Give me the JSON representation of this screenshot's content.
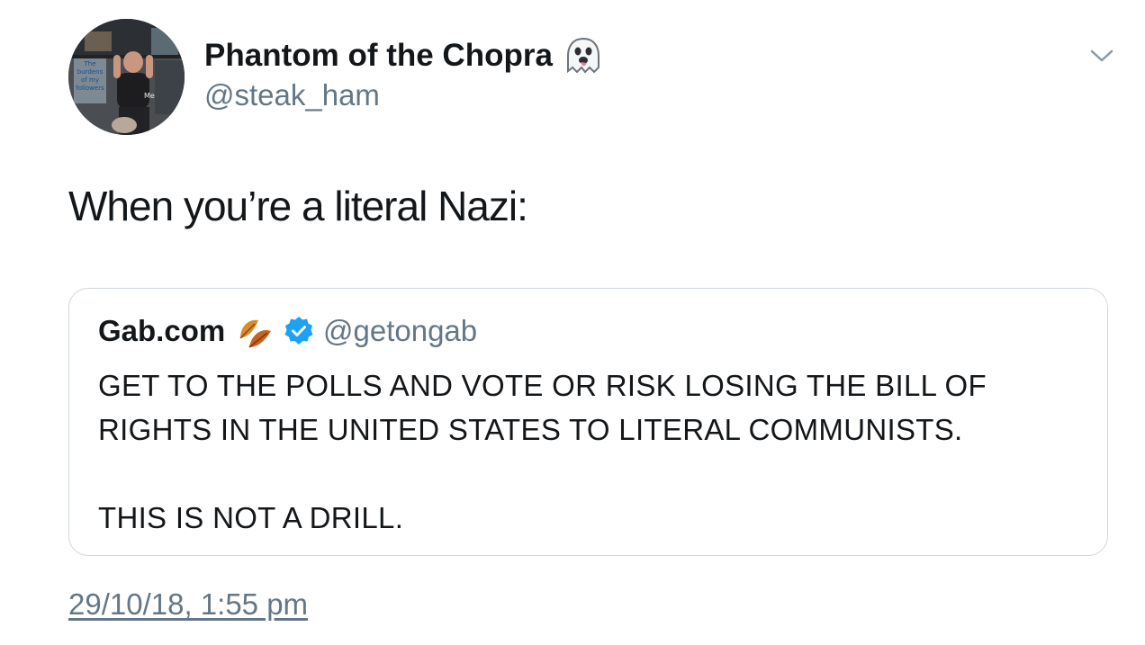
{
  "tweet": {
    "author": {
      "display_name": "Phantom of the Chopra",
      "name_emoji_icon": "ghost-emoji-icon",
      "handle": "@steak_ham",
      "avatar_caption_left": "The burdens of my followers",
      "avatar_caption_right": "Me"
    },
    "menu_icon": "chevron-down-icon",
    "text": "When you’re a literal Nazi:",
    "timestamp": "29/10/18, 1:55 pm"
  },
  "quoted_tweet": {
    "display_name": "Gab.com",
    "name_emoji_icon": "fallen-leaf-emoji-icon",
    "verified_icon": "verified-badge-icon",
    "handle": "@getongab",
    "lines": [
      "GET TO THE POLLS AND VOTE OR RISK LOSING THE BILL OF",
      "RIGHTS IN THE UNITED STATES TO LITERAL COMMUNISTS.",
      "THIS IS NOT A DRILL."
    ]
  },
  "colors": {
    "text": "#14171a",
    "secondary_text": "#657786",
    "border": "#d0d8de",
    "verified": "#1da1f2"
  }
}
